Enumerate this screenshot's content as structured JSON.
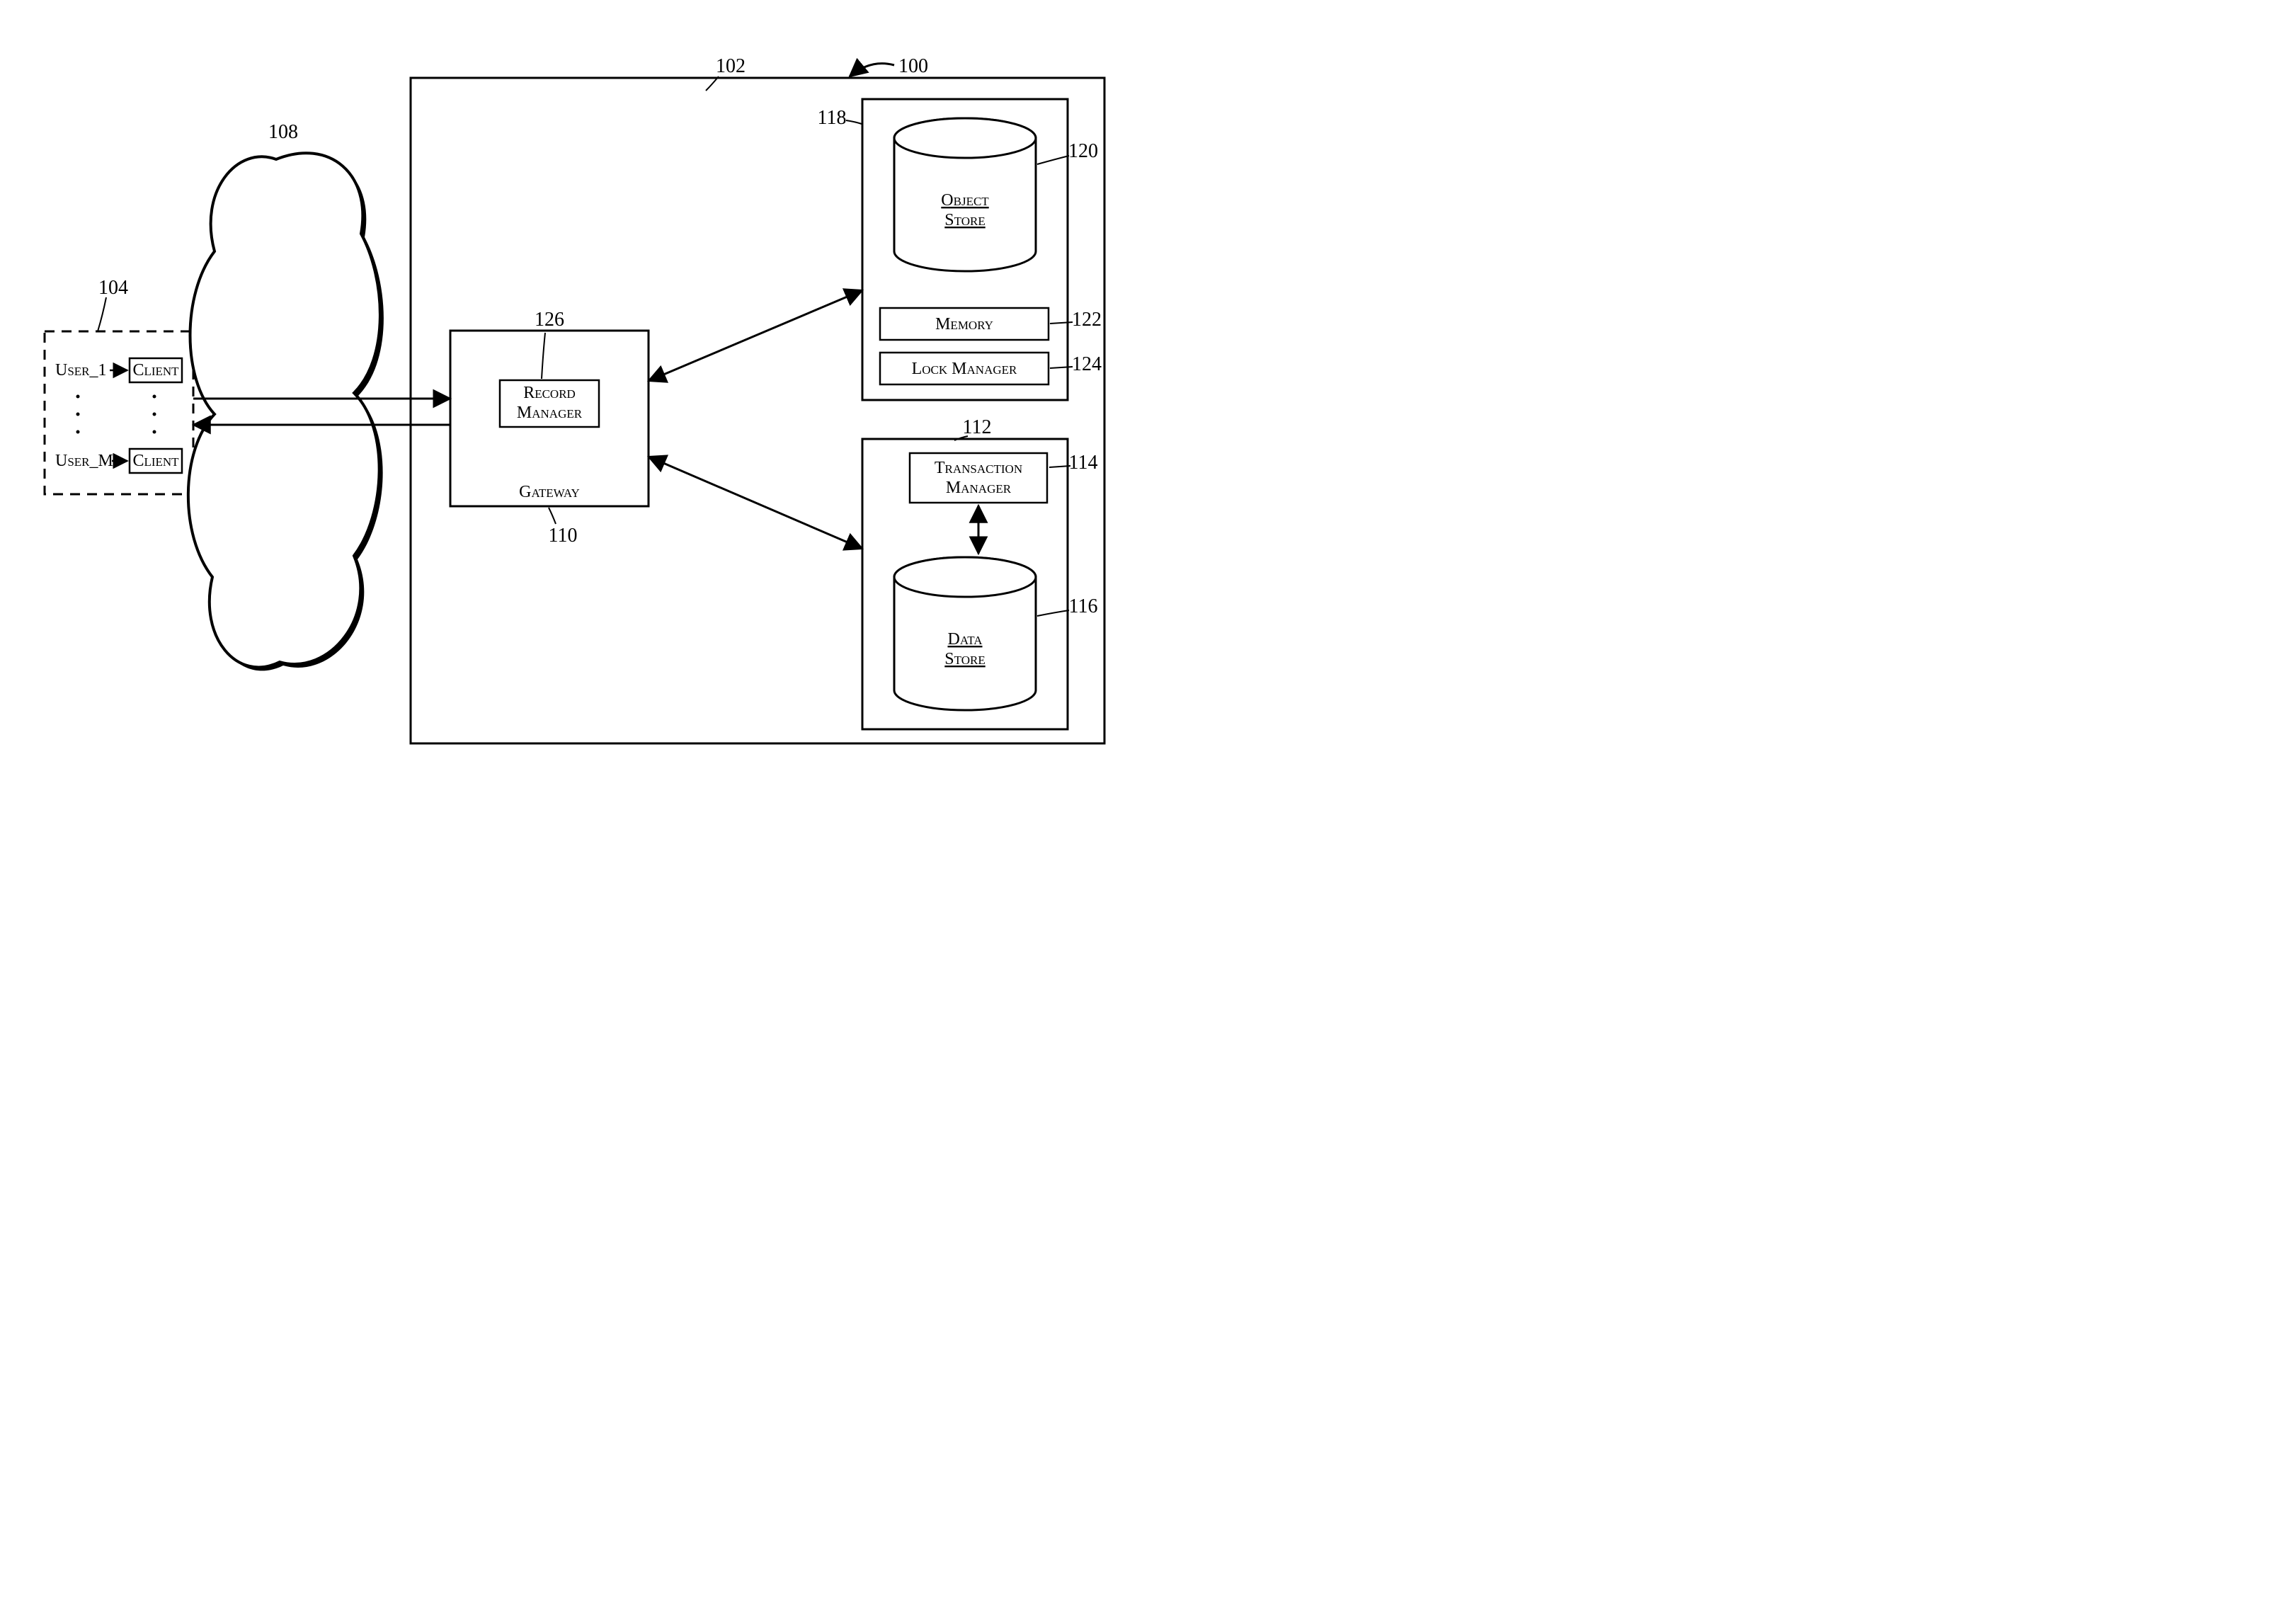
{
  "refs": {
    "system": "100",
    "server_block": "102",
    "client_block": "104",
    "cloud": "108",
    "gateway": "110",
    "storage_block": "112",
    "txn_manager": "114",
    "data_store": "116",
    "object_block": "118",
    "object_store": "120",
    "memory": "122",
    "lock_manager": "124",
    "record_manager": "126"
  },
  "users": {
    "first": "User_1",
    "last": "User_M"
  },
  "labels": {
    "client": "Client",
    "gateway": "Gateway",
    "record_manager": "Record",
    "record_manager2": "Manager",
    "object_store": "Object",
    "object_store2": "Store",
    "memory": "Memory",
    "lock_manager": "Lock Manager",
    "transaction": "Transaction",
    "transaction2": "Manager",
    "data_store": "Data",
    "data_store2": "Store"
  }
}
